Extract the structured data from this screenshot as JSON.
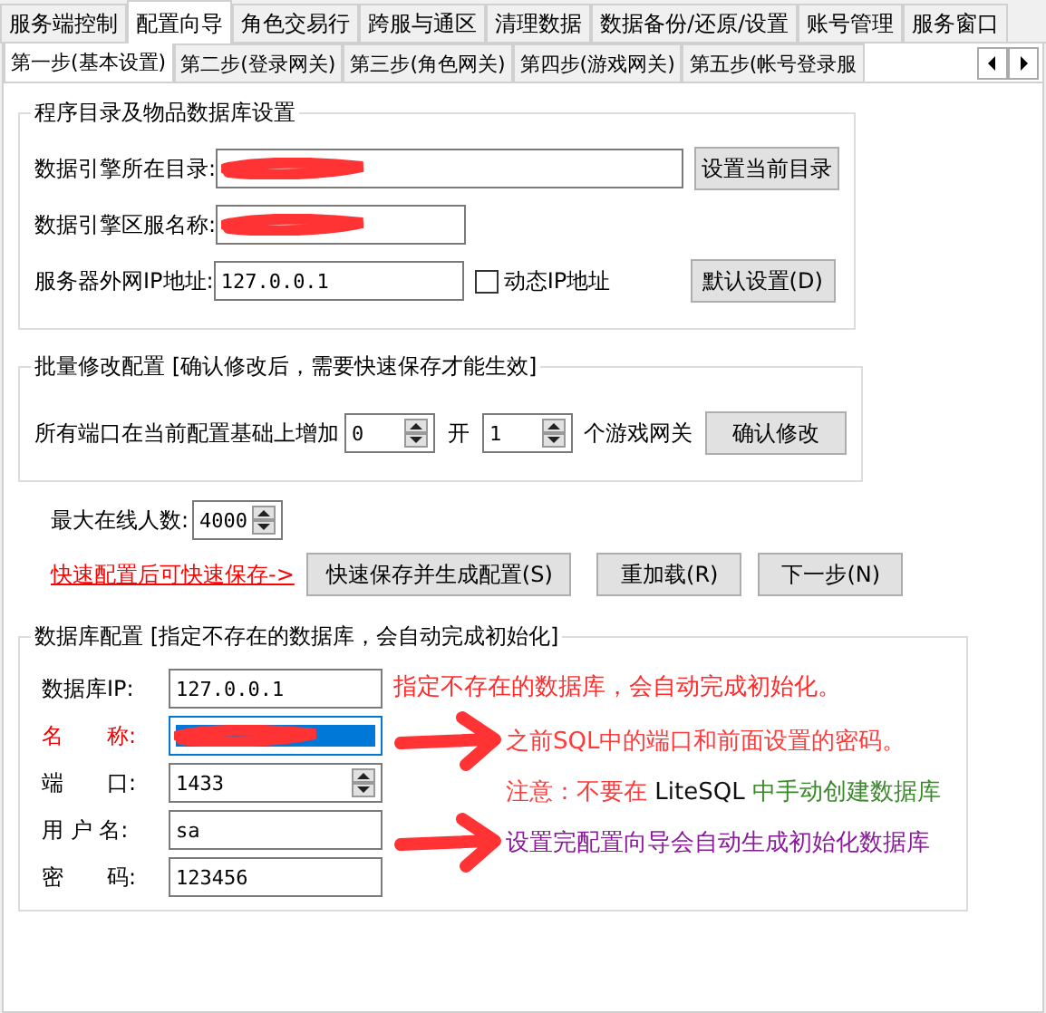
{
  "top_tabs": [
    {
      "label": "服务端控制",
      "selected": false
    },
    {
      "label": "配置向导",
      "selected": true
    },
    {
      "label": "角色交易行",
      "selected": false
    },
    {
      "label": "跨服与通区",
      "selected": false
    },
    {
      "label": "清理数据",
      "selected": false
    },
    {
      "label": "数据备份/还原/设置",
      "selected": false
    },
    {
      "label": "账号管理",
      "selected": false
    },
    {
      "label": "服务窗口",
      "selected": false
    }
  ],
  "step_tabs": [
    {
      "label": "第一步(基本设置)",
      "selected": true
    },
    {
      "label": "第二步(登录网关)",
      "selected": false
    },
    {
      "label": "第三步(角色网关)",
      "selected": false
    },
    {
      "label": "第四步(游戏网关)",
      "selected": false
    },
    {
      "label": "第五步(帐号登录服",
      "selected": false
    }
  ],
  "directory_group": {
    "title": "程序目录及物品数据库设置",
    "engine_dir": {
      "label": "数据引擎所在目录:",
      "redacted": true
    },
    "set_dir_button": "设置当前目录",
    "server_name": {
      "label": "数据引擎区服名称:",
      "redacted": true
    },
    "ip": {
      "label": "服务器外网IP地址:",
      "value": "127.0.0.1"
    },
    "dynamic_ip": {
      "label": "动态IP地址",
      "checked": false
    },
    "default_button": "默认设置(D)"
  },
  "batch_group": {
    "title": "批量修改配置 [确认修改后，需要快速保存才能生效]",
    "prefix": "所有端口在当前配置基础上增加",
    "increase": "0",
    "middle": "开",
    "count": "1",
    "suffix": "个游戏网关",
    "confirm_button": "确认修改"
  },
  "max_online": {
    "label": "最大在线人数:",
    "value": "4000"
  },
  "quick_link": "快速配置后可快速保存->",
  "action_buttons": [
    "快速保存并生成配置(S)",
    "重加载(R)",
    "下一步(N)"
  ],
  "db_group": {
    "title": "数据库配置 [指定不存在的数据库，会自动完成初始化]",
    "fields": [
      {
        "label": "数据库IP:",
        "value": "127.0.0.1",
        "warning": false,
        "kind": "text"
      },
      {
        "label": "名　　称:",
        "redacted": true,
        "selected": true,
        "warning": true,
        "kind": "text"
      },
      {
        "label": "端　　口:",
        "value": "1433",
        "warning": false,
        "kind": "spin"
      },
      {
        "label": "用 户 名:",
        "value": "sa",
        "warning": false,
        "kind": "text"
      },
      {
        "label": "密　　码:",
        "value": "123456",
        "warning": false,
        "kind": "text"
      }
    ]
  },
  "annotations": [
    {
      "segments": [
        {
          "text": "指定不存在的数据库，会自动完成初始化。",
          "color": "#ff2a2a"
        }
      ],
      "arrow": false
    },
    {
      "segments": [
        {
          "text": "之前SQL中的端口和前面设置的密码。",
          "color": "#ff3a3a"
        }
      ],
      "arrow": true
    },
    {
      "segments": [
        {
          "text": "注意：不要在 ",
          "color": "#ff3a3a"
        },
        {
          "text": "LiteSQL",
          "color": "#111111"
        },
        {
          "text": " 中手动创建数据库",
          "color": "#3a8a2a"
        }
      ],
      "arrow": false
    },
    {
      "segments": [
        {
          "text": "设置完配置向导会自动生成初始化数据库",
          "color": "#8a1a9a"
        }
      ],
      "arrow": true
    }
  ]
}
